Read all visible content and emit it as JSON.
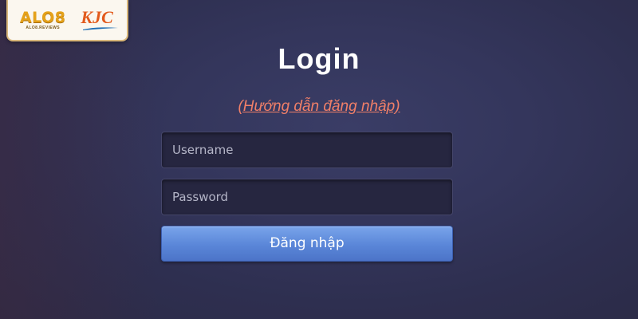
{
  "logo": {
    "alo_text": "ALO8",
    "alo_sub": "ALO8.REVIEWS",
    "kjc_text": "KJC"
  },
  "login": {
    "title": "Login",
    "guide_link": "(Hướng dẫn đăng nhập)",
    "username_placeholder": "Username",
    "password_placeholder": "Password",
    "submit_label": "Đăng nhập"
  },
  "colors": {
    "link": "#f07f68",
    "button": "#5a86d8",
    "background": "#34365c",
    "logo_gold": "#e5a21a",
    "logo_kjc": "#e25a1c"
  }
}
